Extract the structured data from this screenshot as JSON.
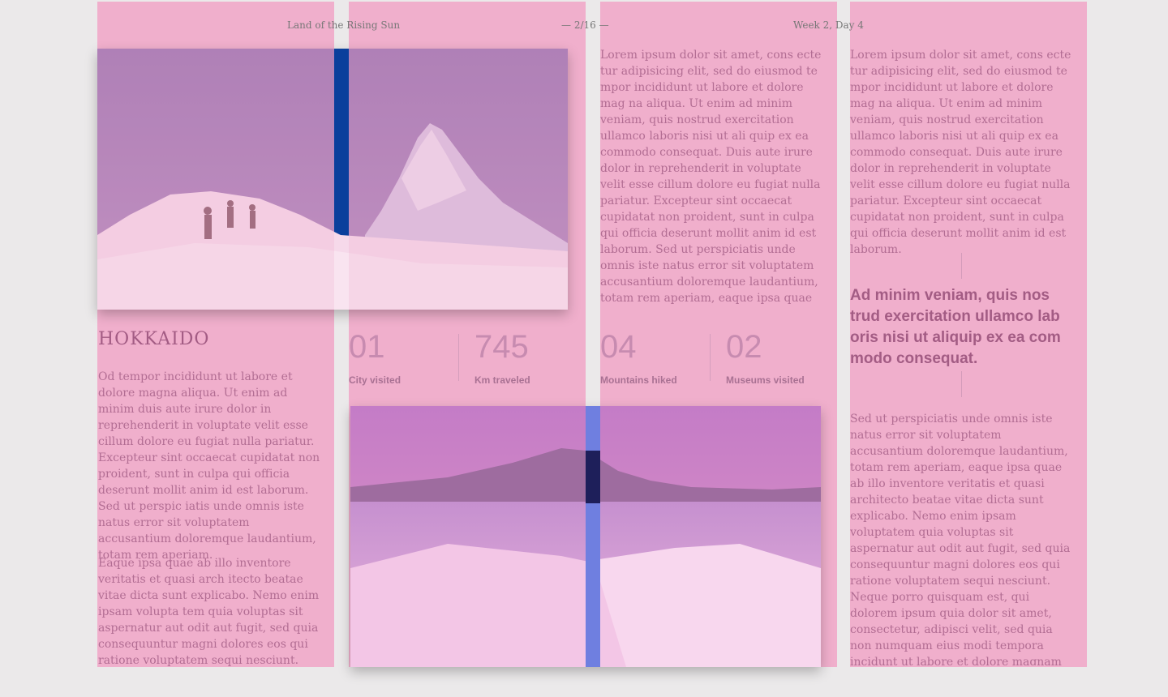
{
  "header": {
    "left": "Land of the Rising Sun",
    "center": "— 2/16 —",
    "right": "Week 2, Day 4"
  },
  "article": {
    "title": "HOKKAIDO",
    "intro": "Od tempor incididunt ut labore et dolore magna aliqua. Ut enim ad minim duis aute irure dolor in reprehenderit in voluptate velit esse cillum dolore eu fugiat nulla pariatur. Excepteur sint occaecat cupidatat non proident, sunt in culpa qui officia deserunt mollit anim id est laborum. Sed ut perspic iatis unde omnis iste natus error sit voluptatem accusantium doloremque laudantium, totam rem aperiam.",
    "intro2": "Eaque ipsa quae ab illo inventore veritatis et quasi arch itecto beatae vitae dicta sunt explicabo. Nemo enim ipsam volupta tem quia voluptas sit aspernatur aut odit aut fugit, sed quia consequuntur magni dolores eos qui ratione voluptatem sequi nesciunt.",
    "col3_text": "Lorem ipsum dolor sit amet, cons ecte tur adipisicing elit, sed do eiusmod te mpor incididunt ut labore et dolore mag na aliqua. Ut enim ad minim veniam, quis nostrud exercitation ullamco laboris nisi ut ali quip ex ea commodo consequat. Duis aute irure dolor in reprehenderit in voluptate velit esse cillum dolore eu fugiat nulla pariatur. Excepteur sint occaecat cupidatat non proident, sunt in culpa qui officia deserunt mollit anim id est laborum. Sed ut perspiciatis unde omnis iste natus error sit voluptatem accusantium doloremque laudantium, totam rem aperiam, eaque ipsa quae ab illo",
    "col4_text": "Lorem ipsum dolor sit amet, cons ecte tur adipisicing elit, sed do eiusmod te mpor incididunt ut labore et dolore mag na aliqua. Ut enim ad minim veniam, quis nostrud exercitation ullamco laboris nisi ut ali quip ex ea commodo consequat. Duis aute irure dolor in reprehenderit in voluptate velit esse cillum dolore eu fugiat nulla pariatur. Excepteur sint occaecat cupidatat non proident, sunt in culpa qui officia deserunt mollit anim id est laborum.",
    "quote": "Ad minim veniam, quis nos trud exercitation ullamco lab oris nisi ut aliquip ex ea com modo consequat.",
    "col4_text2": "Sed ut perspiciatis unde omnis iste natus error sit voluptatem accusantium doloremque laudantium, totam rem aperiam, eaque ipsa quae ab illo inventore veritatis et quasi architecto beatae vitae dicta sunt explicabo. Nemo enim ipsam voluptatem quia voluptas sit aspernatur aut odit aut fugit, sed quia consequuntur magni dolores eos qui ratione voluptatem sequi nesciunt. Neque porro quisquam est, qui dolorem ipsum quia dolor sit amet, consectetur, adipisci velit, sed quia non numquam eius modi tempora incidunt ut labore et dolore magnam aliquam quaerat voluptatem."
  },
  "stats": [
    {
      "value": "01",
      "label": "City visited"
    },
    {
      "value": "745",
      "label": "Km traveled"
    },
    {
      "value": "04",
      "label": "Mountains hiked"
    },
    {
      "value": "02",
      "label": "Museums visited"
    }
  ],
  "colors": {
    "column_overlay": "#f0acca",
    "heading": "#a35c84",
    "body_text": "#b26d93",
    "stat_number": "#c78bb0"
  }
}
